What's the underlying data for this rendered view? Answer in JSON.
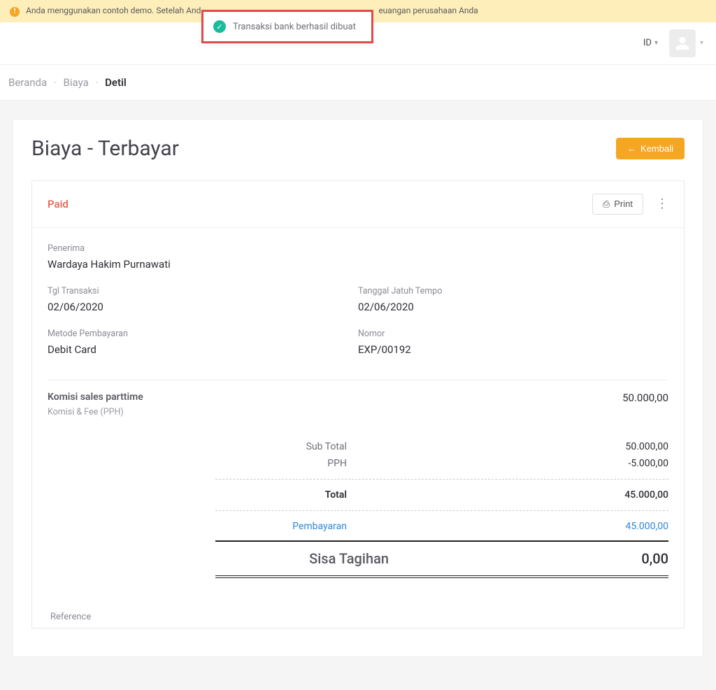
{
  "banner": {
    "text_left": "Anda menggunakan contoh demo. Setelah And",
    "text_right": "euangan perusahaan Anda"
  },
  "toast": {
    "message": "Transaksi bank berhasil dibuat"
  },
  "topbar": {
    "lang": "ID"
  },
  "breadcrumbs": {
    "a": "Beranda",
    "b": "Biaya",
    "c": "Detil"
  },
  "page": {
    "title": "Biaya - Terbayar",
    "back": "Kembali"
  },
  "card": {
    "status": "Paid",
    "print": "Print",
    "recipient_label": "Penerima",
    "recipient": "Wardaya Hakim Purnawati",
    "txdate_label": "Tgl Transaksi",
    "txdate": "02/06/2020",
    "duedate_label": "Tanggal Jatuh Tempo",
    "duedate": "02/06/2020",
    "paymethod_label": "Metode Pembayaran",
    "paymethod": "Debit Card",
    "number_label": "Nomor",
    "number": "EXP/00192",
    "line_title": "Komisi sales parttime",
    "line_sub": "Komisi & Fee (PPH)",
    "line_amount": "50.000,00",
    "subtotal_label": "Sub Total",
    "subtotal": "50.000,00",
    "pph_label": "PPH",
    "pph": "-5.000,00",
    "total_label": "Total",
    "total": "45.000,00",
    "pay_label": "Pembayaran",
    "pay": "45.000,00",
    "sisa_label": "Sisa Tagihan",
    "sisa": "0,00",
    "reference": "Reference"
  }
}
